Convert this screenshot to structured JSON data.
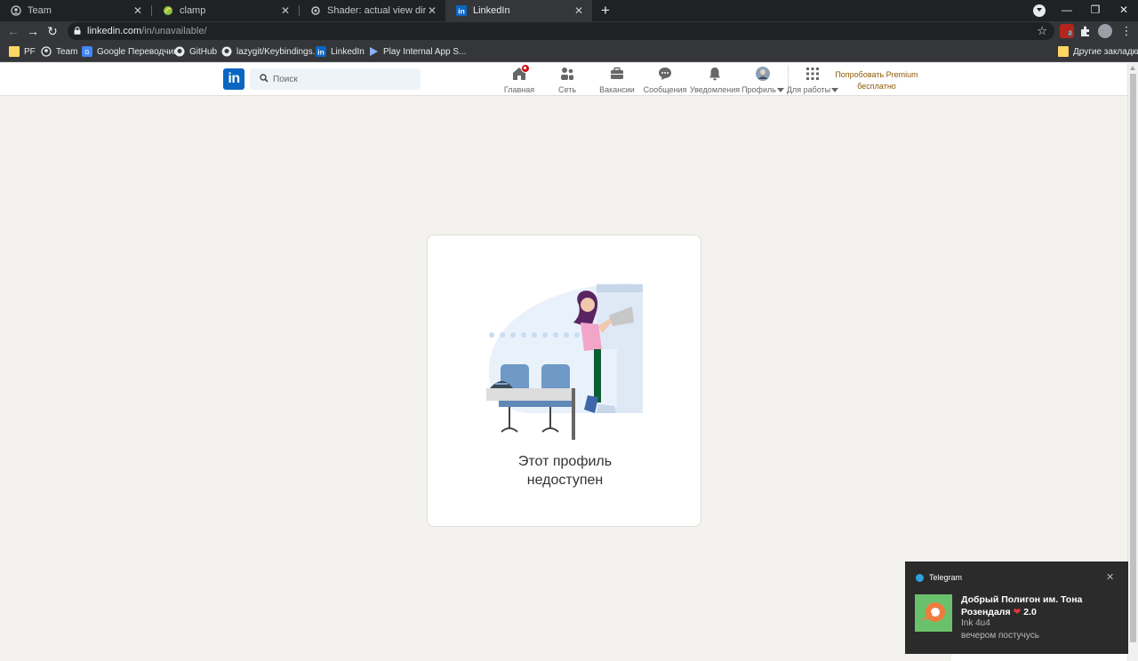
{
  "browser": {
    "tabs": [
      {
        "title": "Team",
        "icon": "team-icon",
        "active": false
      },
      {
        "title": "clamp",
        "icon": "leaf-icon",
        "active": false
      },
      {
        "title": "Shader: actual view direction/nor",
        "icon": "shadertoy-icon",
        "active": false
      },
      {
        "title": "LinkedIn",
        "icon": "linkedin-icon",
        "active": true
      }
    ],
    "new_tab_label": "+",
    "url_host": "linkedin.com",
    "url_path": "/in/unavailable/",
    "bookmarks": [
      {
        "label": "PF",
        "icon": "folder-icon"
      },
      {
        "label": "Team",
        "icon": "team-icon"
      },
      {
        "label": "Google Переводчик",
        "icon": "google-translate-icon"
      },
      {
        "label": "GitHub",
        "icon": "github-icon"
      },
      {
        "label": "lazygit/Keybindings...",
        "icon": "github-icon"
      },
      {
        "label": "LinkedIn",
        "icon": "linkedin-icon"
      },
      {
        "label": "Play Internal App S...",
        "icon": "play-icon"
      }
    ],
    "other_bookmarks": "Другие закладки",
    "ext_badge": "2",
    "colors": {
      "tabstrip": "#202124",
      "toolbar": "#35363a",
      "omnibox": "#202124"
    }
  },
  "linkedin": {
    "logo_text": "in",
    "search_placeholder": "Поиск",
    "nav": [
      {
        "label": "Главная",
        "icon": "home-icon"
      },
      {
        "label": "Сеть",
        "icon": "network-icon"
      },
      {
        "label": "Вакансии",
        "icon": "briefcase-icon"
      },
      {
        "label": "Сообщения",
        "icon": "messaging-icon"
      },
      {
        "label": "Уведомления",
        "icon": "bell-icon"
      },
      {
        "label": "Профиль",
        "icon": "avatar"
      },
      {
        "label": "Для работы",
        "icon": "grid-icon"
      }
    ],
    "premium_line1": "Попробовать Premium",
    "premium_line2": "бесплатно",
    "colors": {
      "brand": "#0a66c2",
      "premium": "#915907",
      "page_bg": "#f3f2ef"
    }
  },
  "card": {
    "message_line1": "Этот профиль",
    "message_line2": "недоступен"
  },
  "toast": {
    "app": "Telegram",
    "title_line1": "Добрый Полигон им. Тона",
    "title_line2": "Розендаля",
    "title_suffix": "2.0",
    "sender": "Ink 4u4",
    "message": "вечером постучусь"
  }
}
